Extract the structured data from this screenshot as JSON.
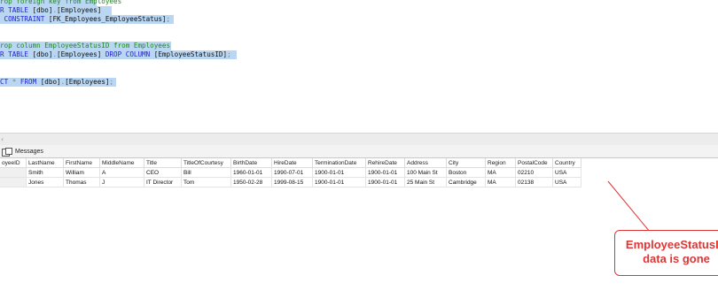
{
  "editor": {
    "lines": [
      {
        "id": "l0",
        "segments": [
          {
            "cls": "cm",
            "text": "rop foreign key from Employees"
          }
        ]
      },
      {
        "id": "l1",
        "segments": [
          {
            "cls": "kw",
            "text": "R TABLE "
          },
          {
            "cls": "tx",
            "text": "[dbo]"
          },
          {
            "cls": "gr",
            "text": "."
          },
          {
            "cls": "tx",
            "text": "[Employees]"
          }
        ]
      },
      {
        "id": "l2",
        "segments": [
          {
            "cls": "kw",
            "text": " CONSTRAINT "
          },
          {
            "cls": "tx",
            "text": "[FK_Employees_EmployeeStatus]"
          },
          {
            "cls": "gr",
            "text": ";"
          }
        ]
      },
      {
        "id": "l3",
        "segments": [
          {
            "cls": "cm",
            "text": "rop column EmployeeStatusID from Employees"
          }
        ]
      },
      {
        "id": "l4",
        "segments": [
          {
            "cls": "kw",
            "text": "R TABLE "
          },
          {
            "cls": "tx",
            "text": "[dbo]"
          },
          {
            "cls": "gr",
            "text": "."
          },
          {
            "cls": "tx",
            "text": "[Employees] "
          },
          {
            "cls": "kw",
            "text": "DROP COLUMN "
          },
          {
            "cls": "tx",
            "text": "[EmployeeStatusID]"
          },
          {
            "cls": "gr",
            "text": ";"
          }
        ]
      },
      {
        "id": "l5",
        "segments": [
          {
            "cls": "kw",
            "text": "CT "
          },
          {
            "cls": "gr",
            "text": "* "
          },
          {
            "cls": "kw",
            "text": "FROM "
          },
          {
            "cls": "tx",
            "text": "[dbo]"
          },
          {
            "cls": "gr",
            "text": "."
          },
          {
            "cls": "tx",
            "text": "[Employees]"
          },
          {
            "cls": "gr",
            "text": ";"
          }
        ]
      }
    ]
  },
  "splitter": {
    "glyph": "‹"
  },
  "results": {
    "tab_label": "Messages",
    "columns": [
      "oyeeID",
      "LastName",
      "FirstName",
      "MiddleName",
      "Title",
      "TitleOfCourtesy",
      "BirthDate",
      "HireDate",
      "TerminationDate",
      "RehireDate",
      "Address",
      "City",
      "Region",
      "PostalCode",
      "Country"
    ],
    "rows": [
      [
        "",
        "Smith",
        "William",
        "A",
        "CEO",
        "Bill",
        "1960-01-01",
        "1990-07-01",
        "1900-01-01",
        "1900-01-01",
        "100 Main St",
        "Boston",
        "MA",
        "02210",
        "USA"
      ],
      [
        "",
        "Jones",
        "Thomas",
        "J",
        "IT Director",
        "Tom",
        "1950-02-28",
        "1999-08-15",
        "1900-01-01",
        "1900-01-01",
        "25 Main St",
        "Cambridge",
        "MA",
        "02138",
        "USA"
      ]
    ]
  },
  "callout": {
    "line1": "EmployeeStatusID",
    "line2": "data is gone",
    "color": "#e03535"
  }
}
